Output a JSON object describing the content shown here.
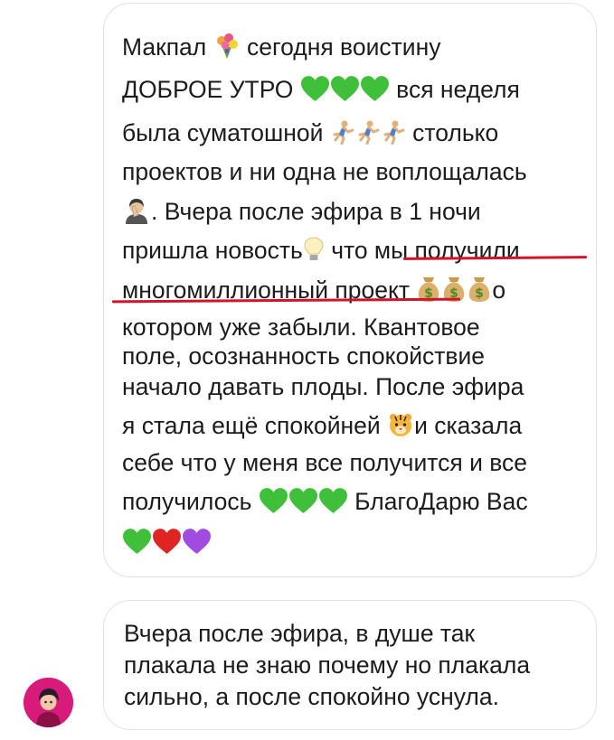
{
  "colors": {
    "bubble_border": "#e2e2e2",
    "text": "#1c1c1c",
    "underline": "#d0152b",
    "green_heart": "#3fbf3a",
    "red_heart": "#e02424",
    "purple_heart": "#a24be0",
    "avatar_bg": "#d81b7a"
  },
  "message_1": {
    "lines": [
      [
        "Макпал",
        "сегодня воистину"
      ],
      [
        "ДОБРОЕ УТРО",
        "вся неделя"
      ],
      [
        "была суматошной",
        "столько"
      ],
      [
        "проектов и ни одна не воплощалась"
      ],
      [
        ". Вчера после эфира в 1 ночи"
      ],
      [
        "пришла новость",
        "что мы получили"
      ],
      [
        "многомиллионный проект",
        "о"
      ],
      [
        "котором уже забыли. Квантовое"
      ],
      [
        "поле, осознанность спокойствие"
      ],
      [
        "начало давать плоды. После эфира"
      ],
      [
        "я стала ещё спокойней",
        "и сказала"
      ],
      [
        "себе что у меня все получится и все"
      ],
      [
        "получилось",
        "БлагоДарю Вас"
      ]
    ],
    "emojis": {
      "bouquet": "bouquet-icon",
      "green_heart": "green-heart-icon",
      "runner": "runner-icon",
      "facepalm": "facepalm-icon",
      "bulb": "light-bulb-icon",
      "money_bag": "money-bag-icon",
      "tiger": "tiger-icon",
      "red_heart": "red-heart-icon",
      "purple_heart": "purple-heart-icon"
    }
  },
  "message_2": {
    "lines": [
      "Вчера после эфира, в душе так",
      "плакала не знаю почему но плакала",
      "сильно, а после спокойно уснула."
    ]
  },
  "avatar": {
    "icon": "user-avatar"
  }
}
